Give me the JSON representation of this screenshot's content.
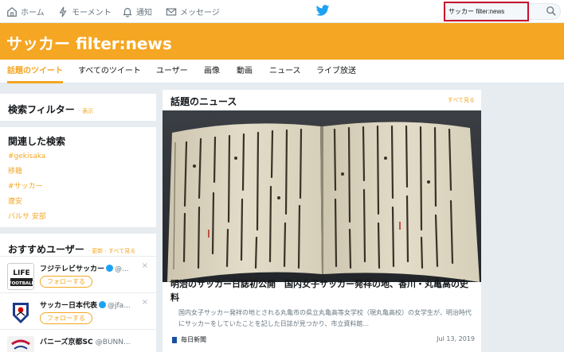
{
  "nav": {
    "home": "ホーム",
    "moments": "モーメント",
    "notifications": "通知",
    "messages": "メッセージ"
  },
  "search": {
    "value": "サッカー filter:news"
  },
  "banner": {
    "title": "サッカー filter:news"
  },
  "tabs": [
    "話題のツイート",
    "すべてのツイート",
    "ユーザー",
    "画像",
    "動画",
    "ニュース",
    "ライブ放送"
  ],
  "filters": {
    "title": "検索フィルター",
    "show": "· 表示"
  },
  "related": {
    "title": "関連した検索",
    "items": [
      "#gekisaka",
      "移籍",
      "#サッカー",
      "遼安",
      "バルサ 安部"
    ]
  },
  "recommended": {
    "title": "おすすめユーザー",
    "links": "· 更新 · すべて見る",
    "follow_label": "フォローする",
    "users": [
      {
        "name": "フジテレビサッカー",
        "handle": "@...",
        "avatar_text": "LIFE FOOTBALL"
      },
      {
        "name": "サッカー日本代表",
        "handle": "@jfa..."
      },
      {
        "name": "バニーズ京都SC",
        "handle": "@BUNN..."
      }
    ]
  },
  "news": {
    "heading": "話題のニュース",
    "see_all": "すべて見る",
    "title": "明治のサッカー日誌初公開　国内女子サッカー発祥の地、香川・丸亀高の史料",
    "body": "国内女子サッカー発祥の地とされる丸亀市の県立丸亀高等女学校（現丸亀高校）の女学生が、明治時代にサッカーをしていたことを記した日誌が見つかり、市立資料館...",
    "source": "毎日新聞",
    "date": "Jul 13, 2019"
  },
  "colors": {
    "accent": "#f5a623",
    "twitter_blue": "#1da1f2",
    "highlight": "#c8102e"
  }
}
